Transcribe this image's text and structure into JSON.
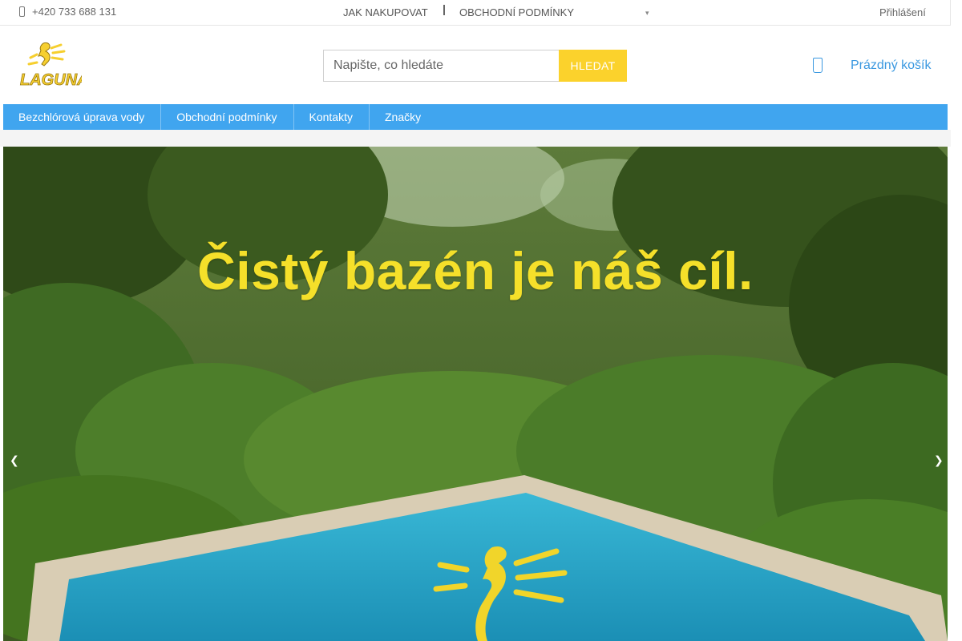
{
  "topbar": {
    "phone": "+420 733 688 131",
    "nav": [
      "JAK NAKUPOVAT",
      "OBCHODNÍ PODMÍNKY"
    ],
    "login": "Přihlášení"
  },
  "header": {
    "logo_text": "LAGUNA",
    "search": {
      "placeholder": "Napište, co hledáte",
      "button": "HLEDAT"
    },
    "cart": {
      "label": "Prázdný košík"
    }
  },
  "menu": {
    "items": [
      "Bezchlórová úprava vody",
      "Obchodní podmínky",
      "Kontakty",
      "Značky"
    ]
  },
  "hero": {
    "headline": "Čistý bazén je náš cíl."
  },
  "colors": {
    "accent_blue": "#40a5ef",
    "search_button": "#fbd22c",
    "headline": "#f5e02a",
    "cart_text": "#3a98e0"
  },
  "icons": {
    "phone": "phone-icon",
    "cart": "cart-icon",
    "dropdown": "chevron-down-icon",
    "prev": "chevron-left-icon",
    "next": "chevron-right-icon"
  }
}
